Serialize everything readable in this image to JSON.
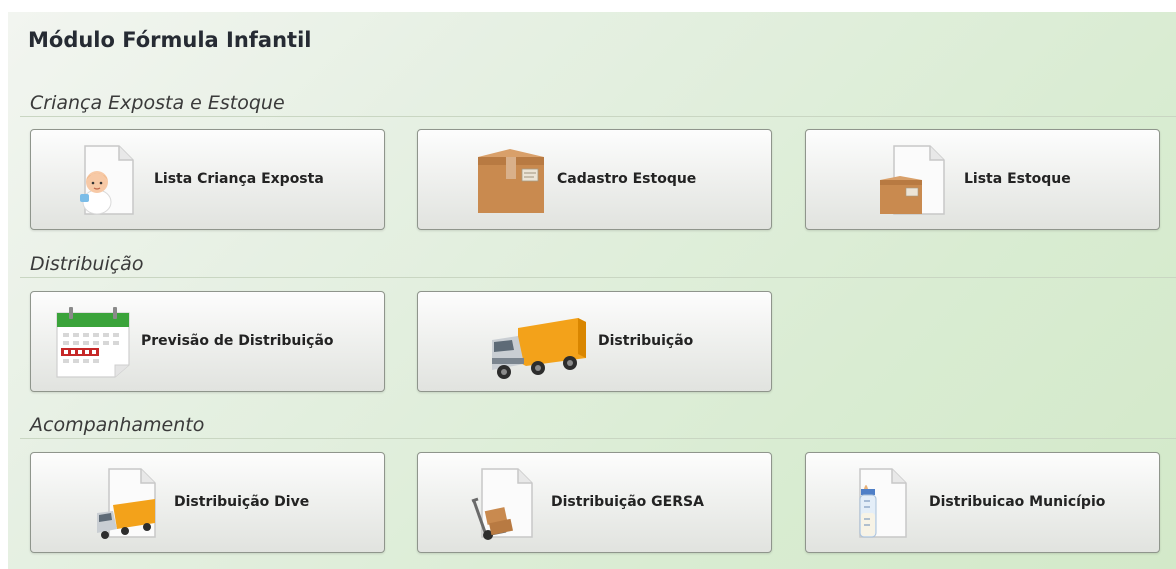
{
  "page": {
    "title": "Módulo Fórmula Infantil"
  },
  "sections": [
    {
      "title": "Criança Exposta e Estoque",
      "items": [
        {
          "label": "Lista Criança Exposta",
          "icon": "baby-document-icon"
        },
        {
          "label": "Cadastro Estoque",
          "icon": "cardboard-box-icon"
        },
        {
          "label": "Lista Estoque",
          "icon": "box-document-icon"
        }
      ]
    },
    {
      "title": "Distribuição",
      "items": [
        {
          "label": "Previsão de Distribuição",
          "icon": "calendar-icon"
        },
        {
          "label": "Distribuição",
          "icon": "delivery-truck-icon"
        }
      ]
    },
    {
      "title": "Acompanhamento",
      "items": [
        {
          "label": "Distribuição Dive",
          "icon": "truck-document-icon"
        },
        {
          "label": "Distribuição GERSA",
          "icon": "hand-truck-document-icon"
        },
        {
          "label": "Distribuicao Município",
          "icon": "baby-bottle-document-icon"
        }
      ]
    }
  ],
  "colors": {
    "background_start": "#f2f5f0",
    "background_end": "#d3e9c9",
    "tile_border": "#8f958c",
    "title_text": "#262b33",
    "calendar_green": "#3aa33a",
    "box_brown": "#c98a4f",
    "truck_orange": "#f3a21a"
  }
}
